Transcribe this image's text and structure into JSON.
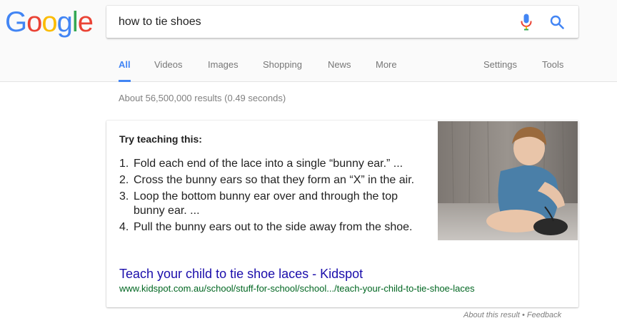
{
  "logo": {
    "letters": [
      "G",
      "o",
      "o",
      "g",
      "l",
      "e"
    ],
    "colors": [
      "#4285f4",
      "#ea4335",
      "#fbbc05",
      "#4285f4",
      "#34a853",
      "#ea4335"
    ]
  },
  "search": {
    "value": "how to tie shoes",
    "mic_icon": "microphone-icon",
    "search_icon": "magnifier-icon"
  },
  "tabs": [
    {
      "label": "All",
      "active": true
    },
    {
      "label": "Videos"
    },
    {
      "label": "Images"
    },
    {
      "label": "Shopping"
    },
    {
      "label": "News"
    },
    {
      "label": "More"
    },
    {
      "label": "Settings"
    },
    {
      "label": "Tools"
    }
  ],
  "result_stats": "About 56,500,000 results (0.49 seconds)",
  "featured": {
    "heading": "Try teaching this:",
    "steps": [
      {
        "num": "1.",
        "text": "Fold each end of the lace into a single “bunny ear.” ..."
      },
      {
        "num": "2.",
        "text": "Cross the bunny ears so that they form an “X” in the air."
      },
      {
        "num": "3.",
        "text": "Loop the bottom bunny ear over and through the top bunny ear. ..."
      },
      {
        "num": "4.",
        "text": "Pull the bunny ears out to the side away from the shoe."
      }
    ],
    "title": "Teach your child to tie shoe laces - Kidspot",
    "url": "www.kidspot.com.au/school/stuff-for-school/school.../teach-your-child-to-tie-shoe-laces"
  },
  "footer": {
    "about": "About this result",
    "separator": "•",
    "feedback": "Feedback"
  },
  "colors": {
    "accent": "#4285f4",
    "link": "#1a0dab",
    "url": "#006621"
  }
}
